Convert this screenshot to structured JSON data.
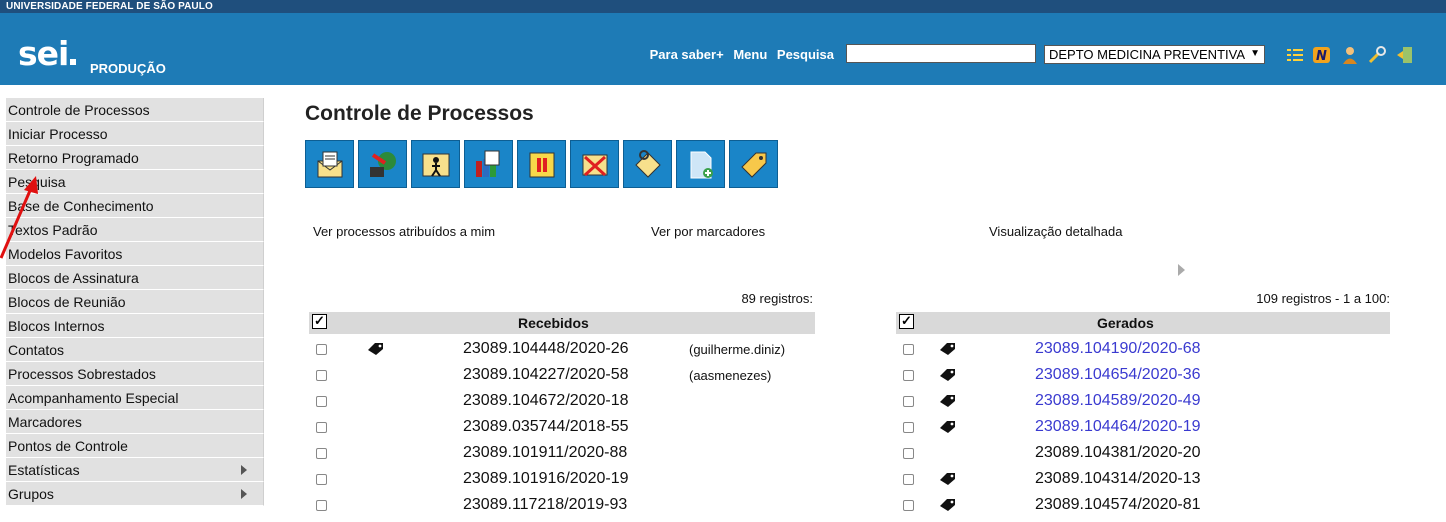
{
  "header": {
    "institution": "UNIVERSIDADE FEDERAL DE SÃO PAULO",
    "logo": "sei",
    "environment": "PRODUÇÃO",
    "links": [
      "Para saber+",
      "Menu",
      "Pesquisa"
    ],
    "search_value": "",
    "unit": "DEPTO MEDICINA PREVENTIVA",
    "icons": [
      "list-icon",
      "n-badge-icon",
      "user-icon",
      "wrench-icon",
      "exit-icon"
    ]
  },
  "sidebar": {
    "items": [
      {
        "label": "Controle de Processos",
        "submenu": false
      },
      {
        "label": "Iniciar Processo",
        "submenu": false
      },
      {
        "label": "Retorno Programado",
        "submenu": false
      },
      {
        "label": "Pesquisa",
        "submenu": false
      },
      {
        "label": "Base de Conhecimento",
        "submenu": false
      },
      {
        "label": "Textos Padrão",
        "submenu": false
      },
      {
        "label": "Modelos Favoritos",
        "submenu": false
      },
      {
        "label": "Blocos de Assinatura",
        "submenu": false
      },
      {
        "label": "Blocos de Reunião",
        "submenu": false
      },
      {
        "label": "Blocos Internos",
        "submenu": false
      },
      {
        "label": "Contatos",
        "submenu": false
      },
      {
        "label": "Processos Sobrestados",
        "submenu": false
      },
      {
        "label": "Acompanhamento Especial",
        "submenu": false
      },
      {
        "label": "Marcadores",
        "submenu": false
      },
      {
        "label": "Pontos de Controle",
        "submenu": false
      },
      {
        "label": "Estatísticas",
        "submenu": true
      },
      {
        "label": "Grupos",
        "submenu": true
      }
    ]
  },
  "main": {
    "title": "Controle de Processos",
    "toolbar": [
      "send-process-icon",
      "update-andamento-icon",
      "assign-process-icon",
      "sobrestar-icon",
      "conclude-icon",
      "remove-sobrestamento-icon",
      "annotation-icon",
      "include-document-icon",
      "marker-icon"
    ],
    "view_links": [
      "Ver processos atribuídos a mim",
      "Ver por marcadores",
      "Visualização detalhada"
    ],
    "received": {
      "count": "89 registros:",
      "header": "Recebidos",
      "rows": [
        {
          "number": "23089.104448/2020-26",
          "user": "(guilherme.diniz)",
          "tag": true
        },
        {
          "number": "23089.104227/2020-58",
          "user": "(aasmenezes)",
          "tag": false
        },
        {
          "number": "23089.104672/2020-18",
          "user": "",
          "tag": false
        },
        {
          "number": "23089.035744/2018-55",
          "user": "",
          "tag": false
        },
        {
          "number": "23089.101911/2020-88",
          "user": "",
          "tag": false
        },
        {
          "number": "23089.101916/2020-19",
          "user": "",
          "tag": false
        },
        {
          "number": "23089.117218/2019-93",
          "user": "",
          "tag": false
        }
      ]
    },
    "generated": {
      "count": "109 registros - 1 a 100:",
      "header": "Gerados",
      "rows": [
        {
          "number": "23089.104190/2020-68",
          "tag": true,
          "link": true
        },
        {
          "number": "23089.104654/2020-36",
          "tag": true,
          "link": true
        },
        {
          "number": "23089.104589/2020-49",
          "tag": true,
          "link": true
        },
        {
          "number": "23089.104464/2020-19",
          "tag": true,
          "link": true
        },
        {
          "number": "23089.104381/2020-20",
          "tag": false,
          "link": false
        },
        {
          "number": "23089.104314/2020-13",
          "tag": true,
          "link": false
        },
        {
          "number": "23089.104574/2020-81",
          "tag": true,
          "link": false
        }
      ]
    }
  },
  "colors": {
    "header_blue": "#1e7bb6",
    "top_strip": "#1f4f7d",
    "link_blue": "#3a3ad0",
    "annotation_arrow": "#e01010"
  }
}
